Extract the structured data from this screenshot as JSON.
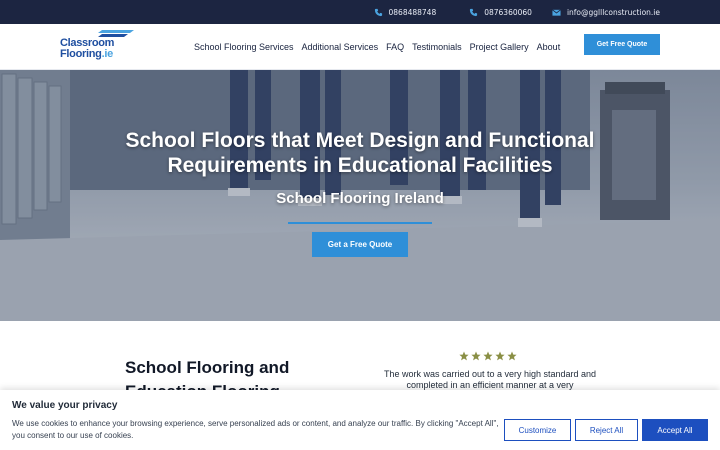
{
  "topbar": {
    "phone1": "0868488748",
    "phone2": "0876360060",
    "email": "info@gglllconstruction.ie",
    "icons": [
      "phone-icon",
      "phone-icon",
      "envelope-icon"
    ]
  },
  "logo": {
    "line1": "Classroom",
    "line2": "Flooring",
    "suffix": ".ie"
  },
  "nav": {
    "items": [
      {
        "label": "School Flooring Services"
      },
      {
        "label": "Additional Services"
      },
      {
        "label": "FAQ"
      },
      {
        "label": "Testimonials"
      },
      {
        "label": "Project Gallery"
      },
      {
        "label": "About"
      }
    ],
    "cta_label": "Get Free Quote"
  },
  "hero": {
    "title": "School Floors that Meet Design and Functional Requirements in Educational Facilities",
    "subtitle": "School Flooring Ireland",
    "cta_label": "Get a Free Quote"
  },
  "intro": {
    "title": "School Flooring and Education Flooring",
    "rating": 5,
    "review": "The work was carried out to a very high standard and completed in an efficient manner at a very"
  },
  "cookie": {
    "title": "We value your privacy",
    "text": "We use cookies to enhance your browsing experience, serve personalized ads or content, and analyze our traffic. By clicking \"Accept All\", you consent to our use of cookies.",
    "customize_label": "Customize",
    "reject_label": "Reject All",
    "accept_label": "Accept All"
  },
  "colors": {
    "topbar_bg": "#1c2541",
    "accent": "#2f8fd8",
    "cookie_accent": "#1d4fbf",
    "star": "#8a8f45"
  }
}
